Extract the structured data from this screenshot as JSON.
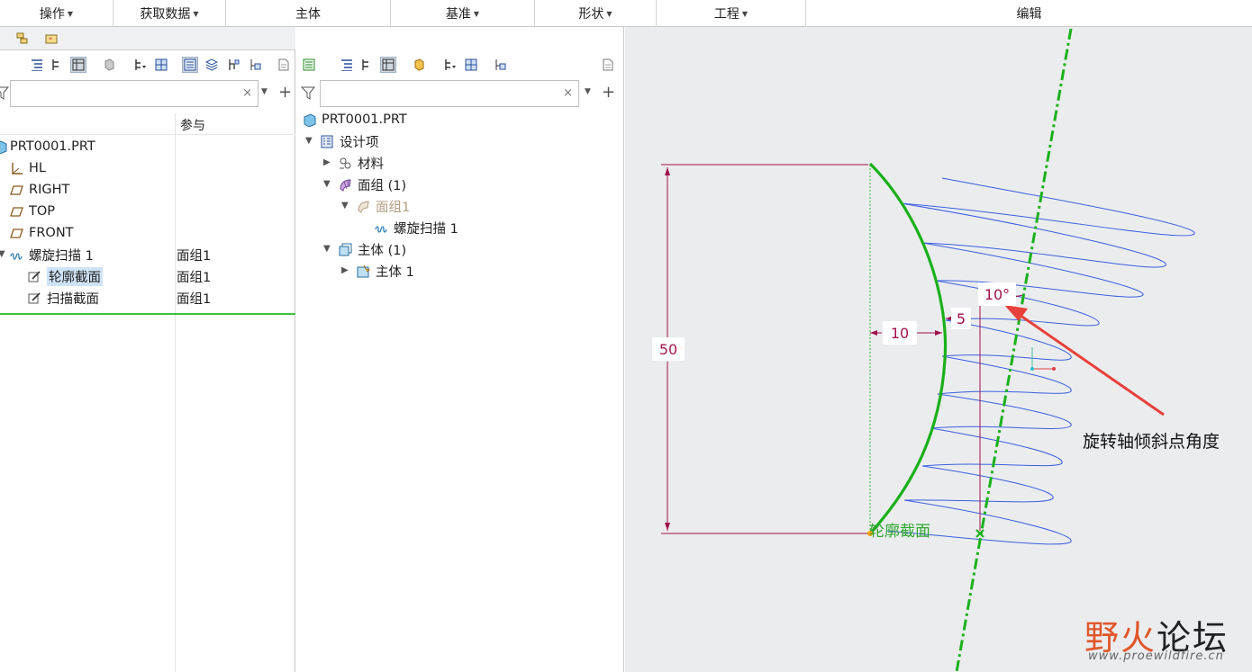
{
  "ribbon": {
    "groups": [
      {
        "label": "操作",
        "dropdown": true
      },
      {
        "label": "获取数据",
        "dropdown": true
      },
      {
        "label": "主体",
        "dropdown": false
      },
      {
        "label": "基准",
        "dropdown": true
      },
      {
        "label": "形状",
        "dropdown": true
      },
      {
        "label": "工程",
        "dropdown": true
      },
      {
        "label": "编辑",
        "dropdown": false
      }
    ]
  },
  "left_tree": {
    "column_header": "参与",
    "search_clear": "×",
    "items": [
      {
        "label": "PRT0001.PRT",
        "icon": "part-icon",
        "value": ""
      },
      {
        "label": "HL",
        "icon": "axis-icon",
        "value": ""
      },
      {
        "label": "RIGHT",
        "icon": "datum-plane-icon",
        "value": ""
      },
      {
        "label": "TOP",
        "icon": "datum-plane-icon",
        "value": ""
      },
      {
        "label": "FRONT",
        "icon": "datum-plane-icon",
        "value": ""
      },
      {
        "label": "螺旋扫描 1",
        "icon": "helical-sweep-icon",
        "value": "面组1"
      },
      {
        "label": "轮廓截面",
        "icon": "sketch-icon",
        "value": "面组1",
        "selected": true
      },
      {
        "label": "扫描截面",
        "icon": "sketch-icon",
        "value": "面组1"
      }
    ]
  },
  "mid_tree": {
    "search_clear": "×",
    "items": [
      {
        "label": "PRT0001.PRT",
        "icon": "part-icon"
      },
      {
        "label": "设计项",
        "icon": "design-items-icon"
      },
      {
        "label": "材料",
        "icon": "material-icon"
      },
      {
        "label": "面组 (1)",
        "icon": "quilt-icon"
      },
      {
        "label": "面组1",
        "icon": "quilt-icon",
        "muted": true
      },
      {
        "label": "螺旋扫描 1",
        "icon": "helical-sweep-icon"
      },
      {
        "label": "主体 (1)",
        "icon": "body-icon"
      },
      {
        "label": "主体 1",
        "icon": "body-icon"
      }
    ]
  },
  "graphics": {
    "dim_height": "50",
    "dim_offset": "10",
    "dim_axis_offset": "5",
    "dim_angle": "10°",
    "profile_label": "轮廓截面",
    "annotation": "旋转轴倾斜点角度",
    "colors": {
      "profile": "#1ab01a",
      "dimension": "#a0104a",
      "helix": "#3a5fe0",
      "arrow": "#e8403a",
      "centerline": "#19b219"
    }
  },
  "watermark": {
    "text_a": "野",
    "text_b": "火",
    "text_c": "论坛",
    "url": "www.proewildfire.cn"
  }
}
